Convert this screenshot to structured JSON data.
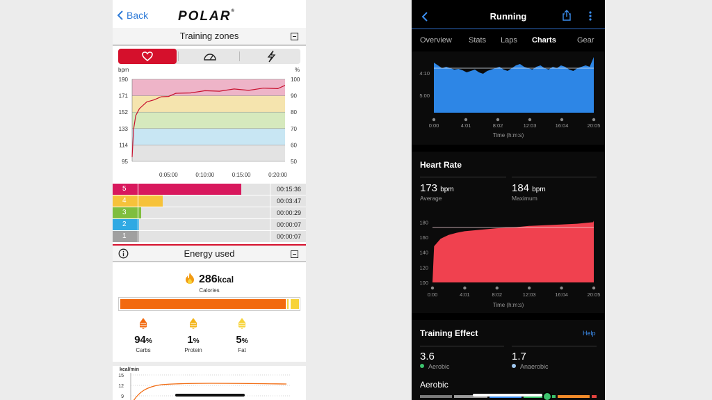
{
  "polar": {
    "back_label": "Back",
    "logo_text": "POLAR",
    "training_zones_title": "Training zones",
    "chart_units_left": "bpm",
    "chart_units_right": "%",
    "energy_title": "Energy used",
    "calories_value": "286",
    "calories_unit": "kcal",
    "calories_label": "Calories",
    "macros": [
      {
        "value": "94",
        "unit": "%",
        "label": "Carbs"
      },
      {
        "value": "1",
        "unit": "%",
        "label": "Protein"
      },
      {
        "value": "5",
        "unit": "%",
        "label": "Fat"
      }
    ],
    "kcal_chart_label": "kcal/min",
    "kcal_yticks": [
      "15",
      "12",
      "9"
    ],
    "zones": [
      {
        "num": "5",
        "time": "00:15:36",
        "color": "#d8185d",
        "fraction": 0.79
      },
      {
        "num": "4",
        "time": "00:03:47",
        "color": "#f6c23a",
        "fraction": 0.19
      },
      {
        "num": "3",
        "time": "00:00:29",
        "color": "#7fbe3e",
        "fraction": 0.025
      },
      {
        "num": "2",
        "time": "00:00:07",
        "color": "#2fa9e3",
        "fraction": 0.008
      },
      {
        "num": "1",
        "time": "00:00:07",
        "color": "#a0a0a0",
        "fraction": 0.008
      }
    ],
    "energy_split": {
      "carbs": 0.94,
      "protein": 0.01,
      "fat": 0.05
    }
  },
  "garmin": {
    "title": "Running",
    "tabs": [
      "Overview",
      "Stats",
      "Laps",
      "Charts",
      "Gear"
    ],
    "active_tab": "Charts",
    "pace_yticks": [
      "4:10",
      "5:00"
    ],
    "time_ticks": [
      "0:00",
      "4:01",
      "8:02",
      "12:03",
      "16:04",
      "20:05"
    ],
    "time_axis_label": "Time (h:m:s)",
    "hr_title": "Heart Rate",
    "hr_average_value": "173",
    "hr_average_unit": "bpm",
    "hr_average_label": "Average",
    "hr_max_value": "184",
    "hr_max_unit": "bpm",
    "hr_max_label": "Maximum",
    "hr_yticks": [
      "180",
      "160",
      "140",
      "120",
      "100"
    ],
    "te_title": "Training Effect",
    "help_label": "Help",
    "aerobic_value": "3.6",
    "aerobic_label": "Aerobic",
    "anaerobic_value": "1.7",
    "anaerobic_label": "Anaerobic",
    "aerobic_section": "Aerobic",
    "colors": {
      "accent": "#2f6bc6",
      "aerobic_dot": "#3cc36d",
      "anaerobic_dot": "#9fc7ef",
      "hr_fill": "#f0414f",
      "pace_fill": "#2d86e6"
    }
  },
  "chart_data": [
    {
      "type": "line",
      "title": "",
      "ylabel": "bpm",
      "y2label": "%",
      "ylim": [
        95,
        190
      ],
      "yticks": [
        95,
        114,
        133,
        152,
        171,
        190
      ],
      "y2ticks": [
        50,
        60,
        70,
        80,
        90,
        100
      ],
      "xticks": [
        "0:05:00",
        "0:10:00",
        "0:15:00",
        "0:20:00"
      ],
      "zone_bands": [
        {
          "from": 171,
          "to": 190,
          "color": "#eeb4c8"
        },
        {
          "from": 152,
          "to": 171,
          "color": "#f5e4ae"
        },
        {
          "from": 133,
          "to": 152,
          "color": "#d6e9bd"
        },
        {
          "from": 114,
          "to": 133,
          "color": "#c8e6f3"
        },
        {
          "from": 95,
          "to": 114,
          "color": "#e3e3e3"
        }
      ],
      "series": [
        {
          "x": [
            0,
            0.2,
            0.5,
            1,
            2,
            3,
            4,
            5,
            6,
            8,
            10,
            12,
            14,
            16,
            18,
            20,
            21
          ],
          "values": [
            100,
            132,
            148,
            156,
            163,
            167,
            169,
            171,
            173,
            175,
            176,
            177,
            178,
            178,
            179,
            180,
            183
          ]
        }
      ]
    },
    {
      "type": "area",
      "title": "Heart Rate",
      "ylim": [
        100,
        185
      ],
      "yticks": [
        100,
        120,
        140,
        160,
        180
      ],
      "xticks": [
        "0:00",
        "4:01",
        "8:02",
        "12:03",
        "16:04",
        "20:05"
      ],
      "series": [
        {
          "x": [
            0,
            0.2,
            1,
            2,
            3,
            4,
            6,
            8,
            10,
            12,
            14,
            16,
            18,
            20,
            20.08
          ],
          "values": [
            100,
            148,
            158,
            163,
            166,
            168,
            170,
            172,
            173,
            175,
            176,
            177,
            178,
            180,
            182
          ]
        }
      ]
    }
  ]
}
